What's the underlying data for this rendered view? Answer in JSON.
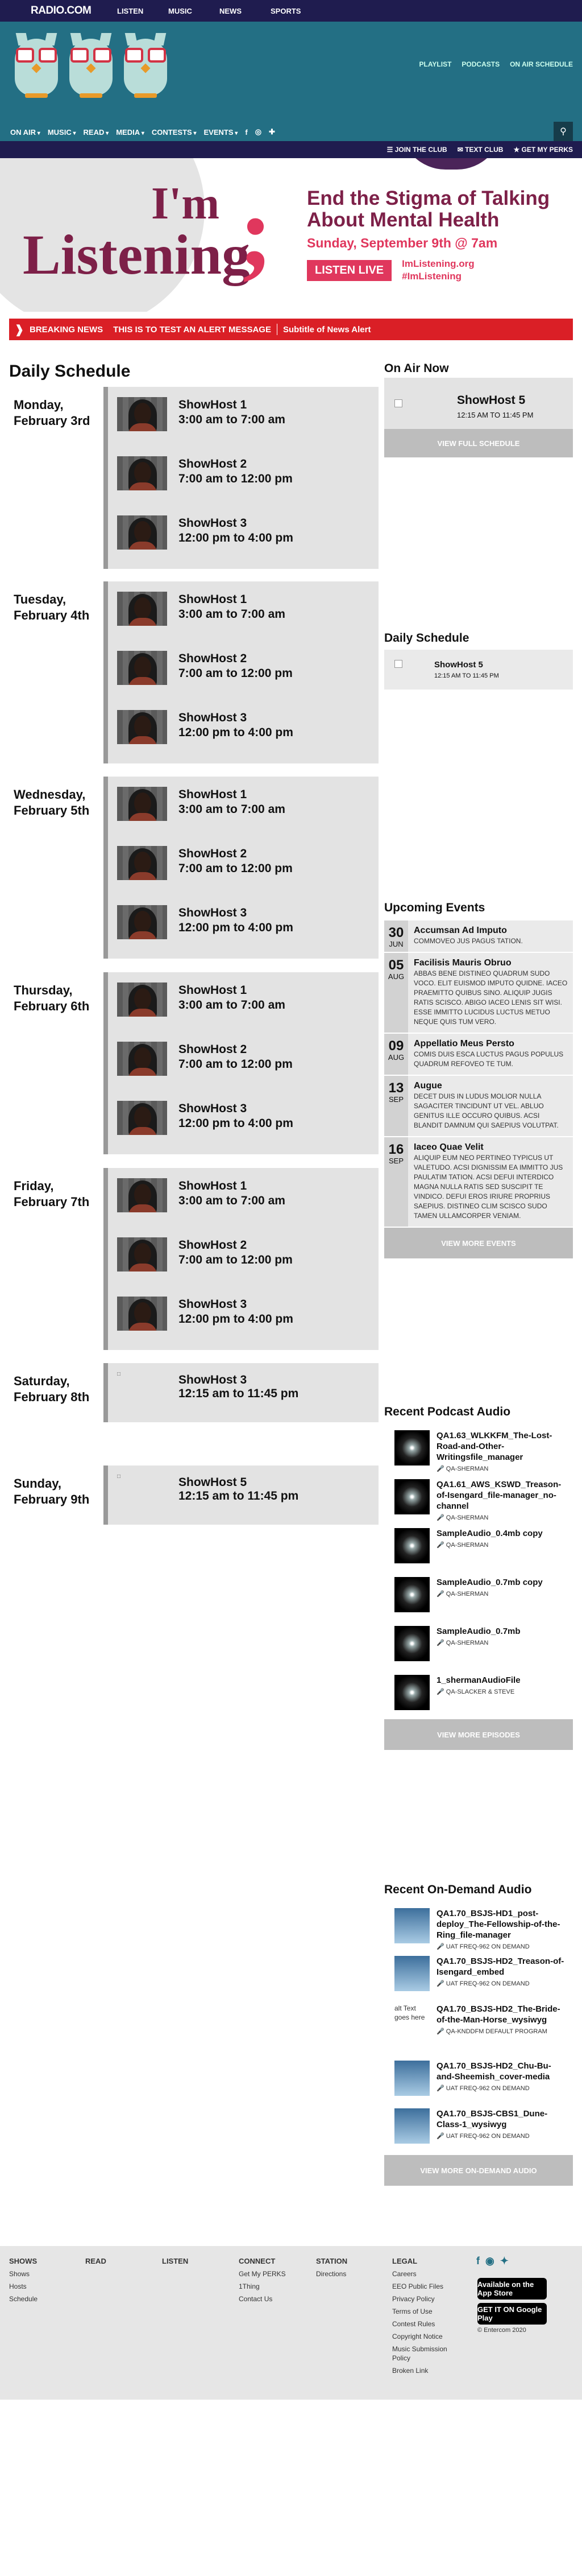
{
  "topbar": {
    "logo": "RADIO.COM",
    "nav": [
      "LISTEN",
      "MUSIC",
      "NEWS",
      "SPORTS"
    ]
  },
  "header": {
    "links": [
      "PLAYLIST",
      "PODCASTS",
      "ON AIR SCHEDULE"
    ],
    "nav": [
      "ON AIR",
      "MUSIC",
      "READ",
      "MEDIA",
      "CONTESTS",
      "EVENTS"
    ],
    "social": [
      "f",
      "◎",
      "✚"
    ],
    "search_icon": "search-icon",
    "bar": [
      "JOIN THE CLUB",
      "TEXT CLUB",
      "GET MY PERKS"
    ]
  },
  "banner": {
    "im": "I'm",
    "listening": "Listening",
    "semicolon": ";",
    "headline": "End the Stigma of Talking About Mental Health",
    "date": "Sunday, September 9th @ 7am",
    "button": "LISTEN LIVE",
    "link1": "ImListening.org",
    "link2": "#ImListening"
  },
  "alert": {
    "label": "BREAKING NEWS",
    "message": "THIS IS TO TEST AN ALERT MESSAGE",
    "subtitle": "Subtitle of News Alert"
  },
  "page_title": "Daily Schedule",
  "schedule": [
    {
      "day": "Monday, February 3rd",
      "slots": [
        {
          "name": "ShowHost 1",
          "time": "3:00 am to 7:00 am"
        },
        {
          "name": "ShowHost 2",
          "time": "7:00 am to 12:00 pm"
        },
        {
          "name": "ShowHost 3",
          "time": "12:00 pm to 4:00 pm"
        }
      ]
    },
    {
      "day": "Tuesday, February 4th",
      "slots": [
        {
          "name": "ShowHost 1",
          "time": "3:00 am to 7:00 am"
        },
        {
          "name": "ShowHost 2",
          "time": "7:00 am to 12:00 pm"
        },
        {
          "name": "ShowHost 3",
          "time": "12:00 pm to 4:00 pm"
        }
      ]
    },
    {
      "day": "Wednesday, February 5th",
      "slots": [
        {
          "name": "ShowHost 1",
          "time": "3:00 am to 7:00 am"
        },
        {
          "name": "ShowHost 2",
          "time": "7:00 am to 12:00 pm"
        },
        {
          "name": "ShowHost 3",
          "time": "12:00 pm to 4:00 pm"
        }
      ]
    },
    {
      "day": "Thursday, February 6th",
      "slots": [
        {
          "name": "ShowHost 1",
          "time": "3:00 am to 7:00 am"
        },
        {
          "name": "ShowHost 2",
          "time": "7:00 am to 12:00 pm"
        },
        {
          "name": "ShowHost 3",
          "time": "12:00 pm to 4:00 pm"
        }
      ]
    },
    {
      "day": "Friday, February 7th",
      "slots": [
        {
          "name": "ShowHost 1",
          "time": "3:00 am to 7:00 am"
        },
        {
          "name": "ShowHost 2",
          "time": "7:00 am to 12:00 pm"
        },
        {
          "name": "ShowHost 3",
          "time": "12:00 pm to 4:00 pm"
        }
      ]
    },
    {
      "day": "Saturday, February 8th",
      "slots": [
        {
          "name": "ShowHost 3",
          "time": "12:15 am to 11:45 pm"
        }
      ]
    },
    {
      "day": "Sunday, February 9th",
      "slots": [
        {
          "name": "ShowHost 5",
          "time": "12:15 am to 11:45 pm"
        }
      ]
    }
  ],
  "on_air": {
    "title": "On Air Now",
    "name": "ShowHost 5",
    "time": "12:15 AM TO 11:45 PM",
    "button": "VIEW FULL SCHEDULE"
  },
  "daily_schedule": {
    "title": "Daily Schedule",
    "name": "ShowHost 5",
    "time": "12:15 AM TO 11:45 PM"
  },
  "events": {
    "title": "Upcoming Events",
    "items": [
      {
        "day": "30",
        "month": "JUN",
        "title": "Accumsan Ad Imputo",
        "desc": "COMMOVEO JUS PAGUS TATION."
      },
      {
        "day": "05",
        "month": "AUG",
        "title": "Facilisis Mauris Obruo",
        "desc": "ABBAS BENE DISTINEO QUADRUM SUDO VOCO. ELIT EUISMOD IMPUTO QUIDNE. IACEO PRAEMITTO QUIBUS SINO. ALIQUIP JUGIS RATIS SCISCO. ABIGO IACEO LENIS SIT WISI. ESSE IMMITTO LUCIDUS LUCTUS METUO NEQUE QUIS TUM VERO."
      },
      {
        "day": "09",
        "month": "AUG",
        "title": "Appellatio Meus Persto",
        "desc": "COMIS DUIS ESCA LUCTUS PAGUS POPULUS QUADRUM REFOVEO TE TUM."
      },
      {
        "day": "13",
        "month": "SEP",
        "title": "Augue",
        "desc": "DECET DUIS IN LUDUS MOLIOR NULLA SAGACITER TINCIDUNT UT VEL. ABLUO GENITUS ILLE OCCURO QUIBUS. ACSI BLANDIT DAMNUM QUI SAEPIUS VOLUTPAT."
      },
      {
        "day": "16",
        "month": "SEP",
        "title": "Iaceo Quae Velit",
        "desc": "ALIQUIP EUM NEO PERTINEO TYPICUS UT VALETUDO. ACSI DIGNISSIM EA IMMITTO JUS PAULATIM TATION. ACSI DEFUI INTERDICO MAGNA NULLA RATIS SED SUSCIPIT TE VINDICO. DEFUI EROS IRIURE PROPRIUS SAEPIUS. DISTINEO CLIM SCISCO SUDO TAMEN ULLAMCORPER VENIAM."
      }
    ],
    "button": "VIEW MORE EVENTS"
  },
  "podcasts": {
    "title": "Recent Podcast Audio",
    "items": [
      {
        "title": "QA1.63_WLKKFM_The-Lost-Road-and-Other-Writingsfile_manager",
        "author": "QA-SHERMAN"
      },
      {
        "title": "QA1.61_AWS_KSWD_Treason-of-Isengard_file-manager_no-channel",
        "author": "QA-SHERMAN"
      },
      {
        "title": "SampleAudio_0.4mb copy",
        "author": "QA-SHERMAN"
      },
      {
        "title": "SampleAudio_0.7mb copy",
        "author": "QA-SHERMAN"
      },
      {
        "title": "SampleAudio_0.7mb",
        "author": "QA-SHERMAN"
      },
      {
        "title": "1_shermanAudioFile",
        "author": "QA-SLACKER & STEVE"
      }
    ],
    "button": "VIEW MORE EPISODES"
  },
  "ondemand": {
    "title": "Recent On-Demand Audio",
    "items": [
      {
        "title": "QA1.70_BSJS-HD1_post-deploy_The-Fellowship-of-the-Ring_file-manager",
        "author": "UAT FREQ-962 ON DEMAND"
      },
      {
        "title": "QA1.70_BSJS-HD2_Treason-of-Isengard_embed",
        "author": "UAT FREQ-962 ON DEMAND"
      },
      {
        "title": "QA1.70_BSJS-HD2_The-Bride-of-the-Man-Horse_wysiwyg",
        "author": "QA-KNDDFM DEFAULT PROGRAM",
        "alt": "alt Text goes here"
      },
      {
        "title": "QA1.70_BSJS-HD2_Chu-Bu-and-Sheemish_cover-media",
        "author": "UAT FREQ-962 ON DEMAND"
      },
      {
        "title": "QA1.70_BSJS-CBS1_Dune-Class-1_wysiwyg",
        "author": "UAT FREQ-962 ON DEMAND"
      }
    ],
    "button": "VIEW MORE ON-DEMAND AUDIO"
  },
  "footer": {
    "shows": {
      "title": "SHOWS",
      "items": [
        "Shows",
        "Hosts",
        "Schedule"
      ]
    },
    "read": {
      "title": "READ"
    },
    "listen": {
      "title": "LISTEN"
    },
    "connect": {
      "title": "CONNECT",
      "items": [
        "Get My PERKS",
        "1Thing",
        "Contact Us"
      ]
    },
    "station": {
      "title": "STATION",
      "items": [
        "Directions"
      ]
    },
    "legal": {
      "title": "LEGAL",
      "items": [
        "Careers",
        "EEO Public Files",
        "Privacy Policy",
        "Terms of Use",
        "Contest Rules",
        "Copyright Notice",
        "Music Submission Policy",
        "Broken Link"
      ]
    },
    "appstore": "Available on the App Store",
    "googleplay": "GET IT ON Google Play",
    "copyright": "© Entercom 2020"
  }
}
